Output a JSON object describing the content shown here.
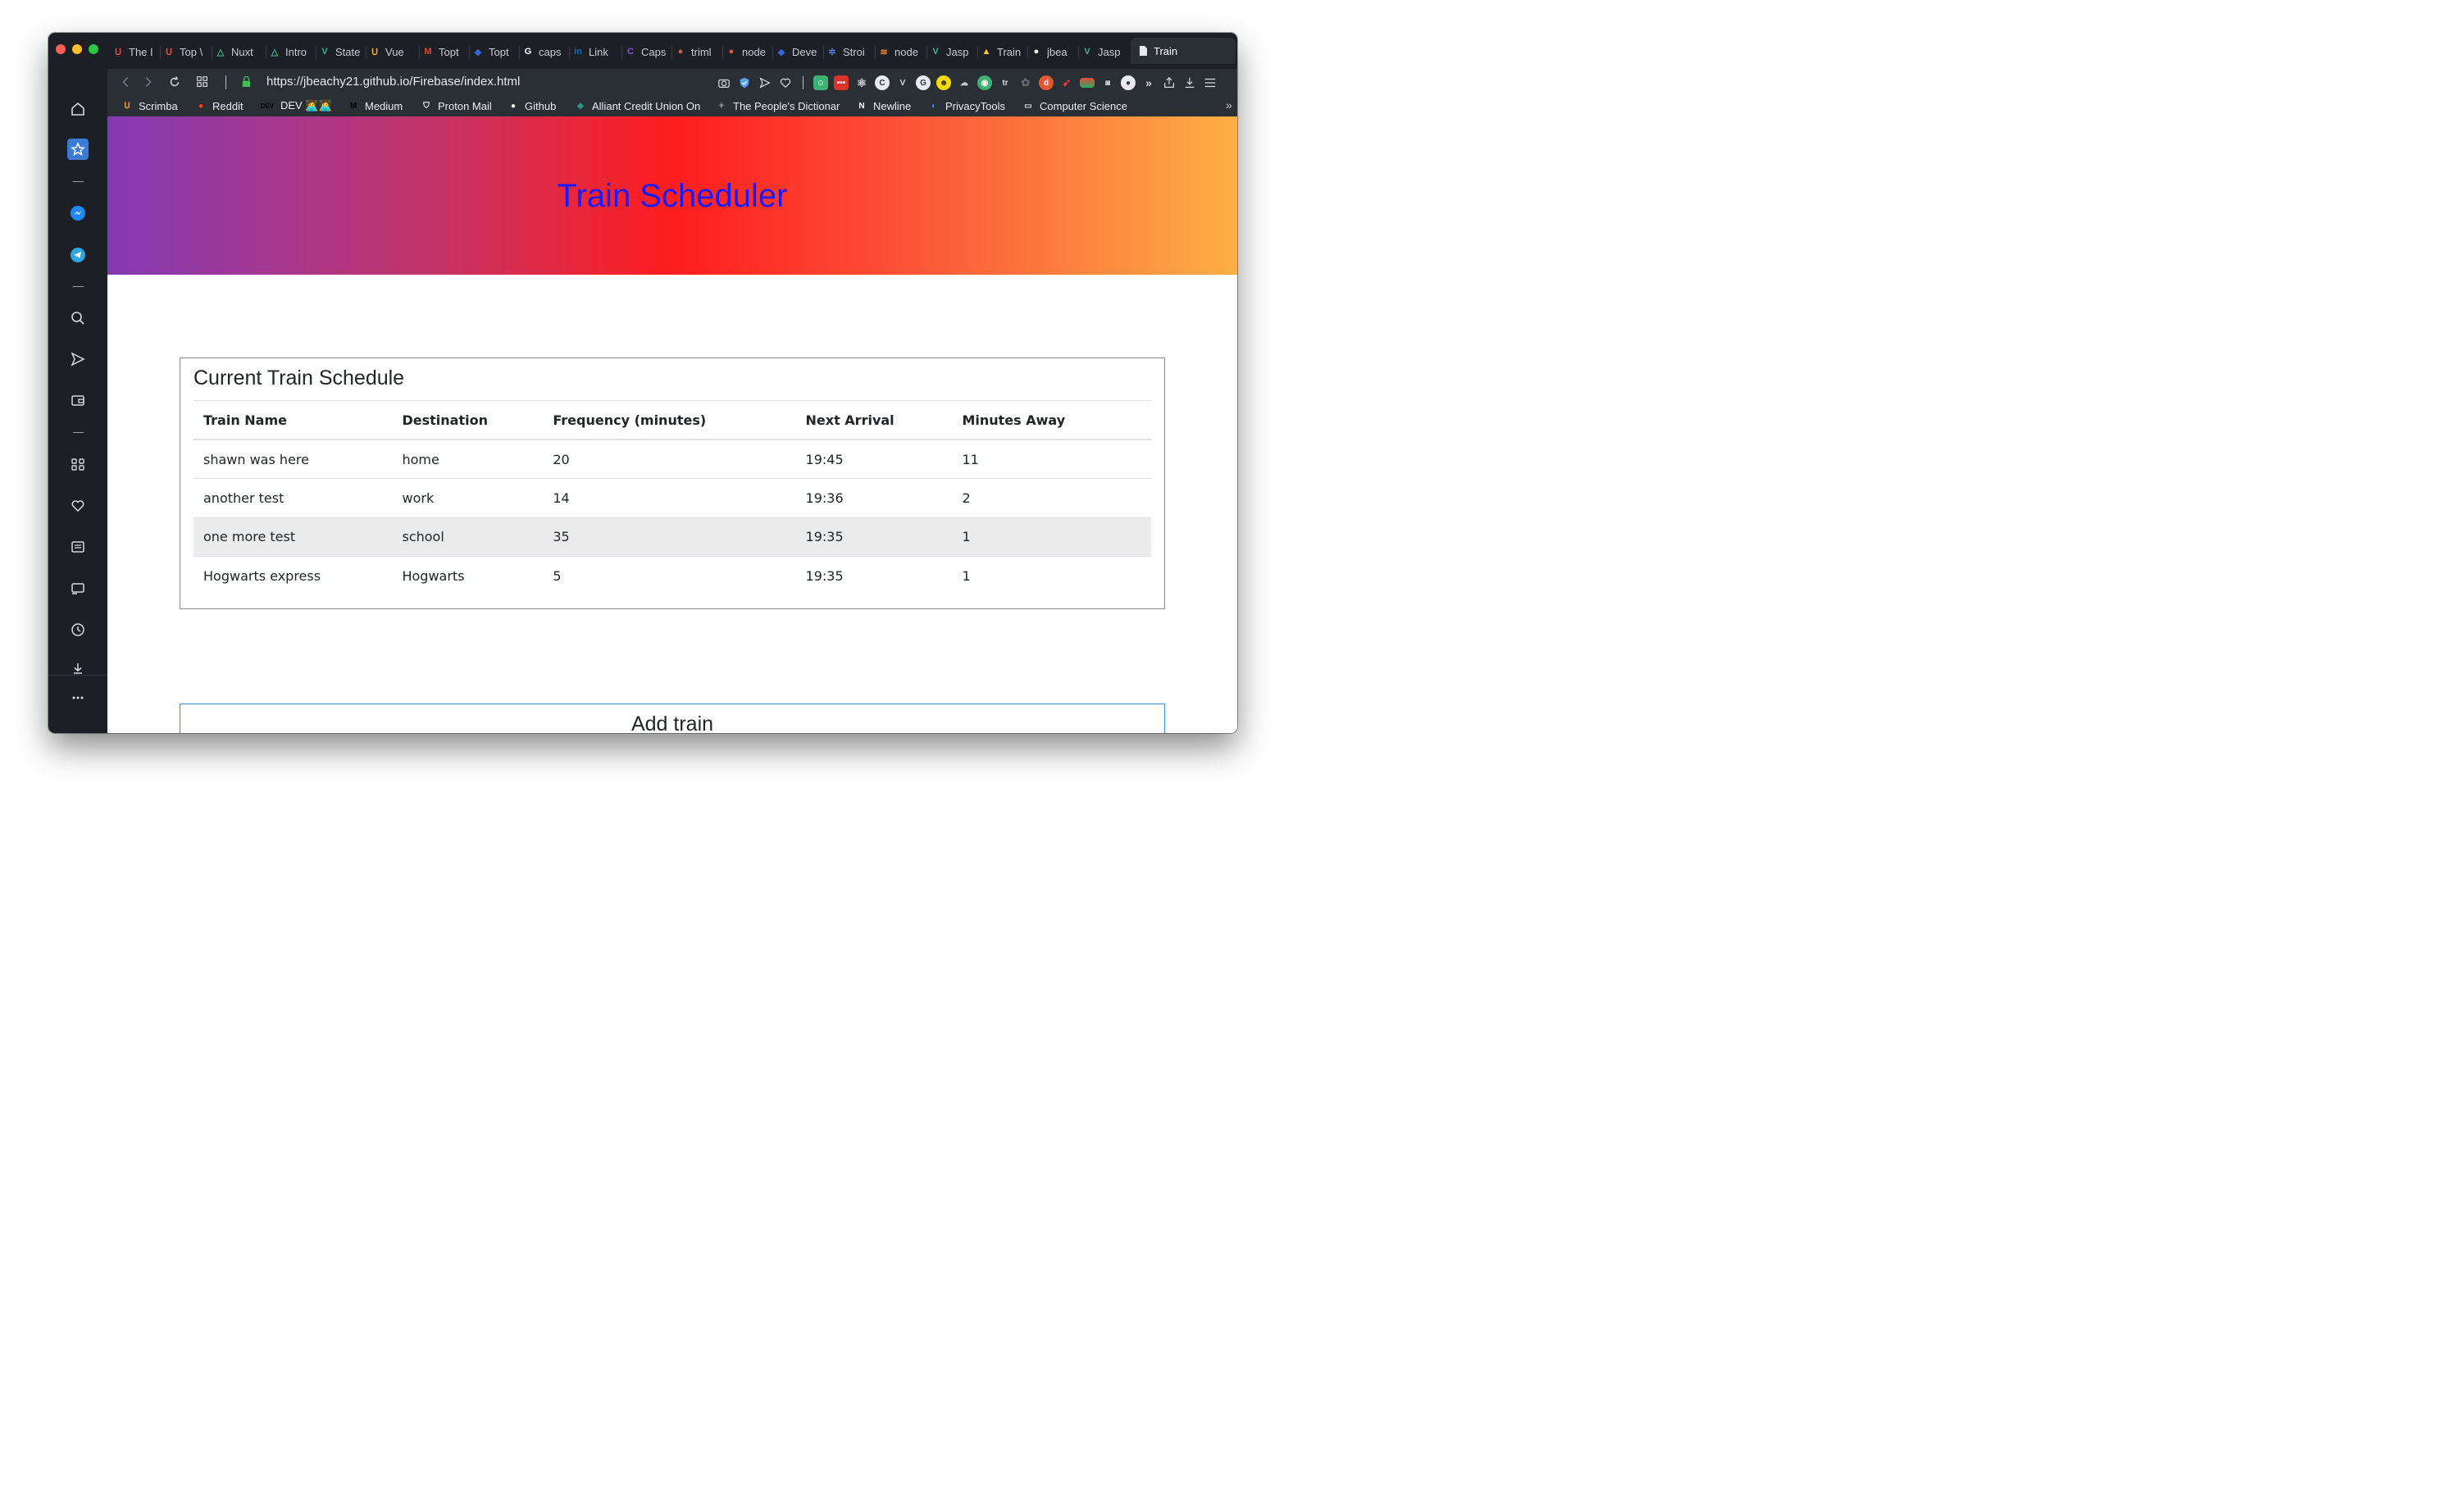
{
  "browser": {
    "tabs": [
      {
        "label": "The I",
        "icon": "scrimba-icon",
        "color": "#e0524b"
      },
      {
        "label": "Top \\",
        "icon": "scrimba-icon",
        "color": "#e0524b"
      },
      {
        "label": "Nuxt",
        "icon": "nuxt-icon",
        "color": "#41b883"
      },
      {
        "label": "Intro",
        "icon": "nuxt-icon",
        "color": "#41b883"
      },
      {
        "label": "State",
        "icon": "vue-icon",
        "color": "#41b883"
      },
      {
        "label": "Vue",
        "icon": "scrimba-icon",
        "color": "#f5a623"
      },
      {
        "label": "Topt",
        "icon": "gmail-icon",
        "color": "#e84335"
      },
      {
        "label": "Topt",
        "icon": "toptal-icon",
        "color": "#3863d6"
      },
      {
        "label": "caps",
        "icon": "google-icon",
        "color": "#ffffff"
      },
      {
        "label": "Link",
        "icon": "linkedin-icon",
        "color": "#0a66c2"
      },
      {
        "label": "Caps",
        "icon": "c-icon",
        "color": "#8a4fe0"
      },
      {
        "label": "triml",
        "icon": "duckduckgo-icon",
        "color": "#de5833"
      },
      {
        "label": "node",
        "icon": "duckduckgo-icon",
        "color": "#de5833"
      },
      {
        "label": "Deve",
        "icon": "toptal-icon",
        "color": "#3863d6"
      },
      {
        "label": "Stroi",
        "icon": "gear-icon",
        "color": "#5a78d6"
      },
      {
        "label": "node",
        "icon": "stackoverflow-icon",
        "color": "#f48024"
      },
      {
        "label": "Jasp",
        "icon": "vue-icon",
        "color": "#41b883"
      },
      {
        "label": "Train",
        "icon": "firebase-icon",
        "color": "#ffca28"
      },
      {
        "label": "jbea",
        "icon": "github-icon",
        "color": "#ffffff"
      },
      {
        "label": "Jasp",
        "icon": "vue-icon",
        "color": "#41b883"
      }
    ],
    "active_tab": {
      "label": "Train",
      "icon": "document-icon"
    },
    "url": "https://jbeachy21.github.io/Firebase/index.html",
    "bookmarks": [
      {
        "label": "Scrimba",
        "icon": "scrimba-icon",
        "color": "#f5a623"
      },
      {
        "label": "Reddit",
        "icon": "reddit-icon",
        "color": "#ff4500"
      },
      {
        "label": "DEV 👩‍💻👩‍💻",
        "icon": "dev-icon",
        "color": "#000000"
      },
      {
        "label": "Medium",
        "icon": "medium-icon",
        "color": "#000000"
      },
      {
        "label": "Proton Mail",
        "icon": "protonmail-icon",
        "color": "#ffffff"
      },
      {
        "label": "Github",
        "icon": "github-icon",
        "color": "#ffffff"
      },
      {
        "label": "Alliant Credit Union On",
        "icon": "alliant-icon",
        "color": "#2a9d8f"
      },
      {
        "label": "The People's Dictionar",
        "icon": "dictionary-icon",
        "color": "#888888"
      },
      {
        "label": "Newline",
        "icon": "newline-icon",
        "color": "#ffffff"
      },
      {
        "label": "PrivacyTools",
        "icon": "privacytools-icon",
        "color": "#3a86ff"
      },
      {
        "label": "Computer Science",
        "icon": "folder-icon",
        "color": "#dddddd"
      }
    ]
  },
  "page": {
    "title": "Train Scheduler",
    "schedule": {
      "heading": "Current Train Schedule",
      "columns": [
        "Train Name",
        "Destination",
        "Frequency (minutes)",
        "Next Arrival",
        "Minutes Away"
      ],
      "rows": [
        [
          "shawn was here",
          "home",
          "20",
          "19:45",
          "11"
        ],
        [
          "another test",
          "work",
          "14",
          "19:36",
          "2"
        ],
        [
          "one more test",
          "school",
          "35",
          "19:35",
          "1"
        ],
        [
          "Hogwarts express",
          "Hogwarts",
          "5",
          "19:35",
          "1"
        ]
      ]
    },
    "add_train": {
      "heading": "Add train"
    }
  },
  "colors": {
    "title_text": "#1a1aff",
    "gradient": [
      "#833ab4",
      "#fd1d1d",
      "#fcb045"
    ],
    "chrome_dark": "#1c1f25",
    "chrome_mid": "#2a2e35"
  }
}
